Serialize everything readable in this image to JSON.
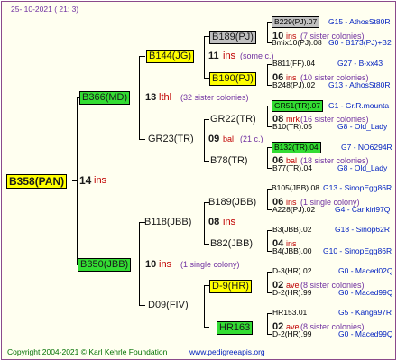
{
  "header": {
    "date": "25- 10-2021 ( 21: 3)"
  },
  "root": {
    "id": "B358(PAN)",
    "num": "14",
    "note": "ins"
  },
  "g1": [
    {
      "id": "B366(MD)",
      "num": "13",
      "note": "lthl",
      "sisters": "(32 sister colonies)"
    },
    {
      "id": "B350(JBB)",
      "num": "10",
      "note": "ins",
      "sisters": "(1 single colony)"
    }
  ],
  "g2": [
    {
      "id": "B144(JG)",
      "num": "11",
      "note": "ins",
      "sisters": "(some c.)"
    },
    {
      "id": "GR23(TR)",
      "num": "09",
      "note": "bal",
      "sisters": "(21 c.)"
    },
    {
      "id": "B118(JBB)",
      "num": "08",
      "note": "ins",
      "sisters": ""
    },
    {
      "id": "D09(FIV)",
      "num": "",
      "note": "",
      "sisters": ""
    }
  ],
  "g3": [
    {
      "id": "B189(PJ)",
      "num": "10",
      "note": "ins",
      "sisters": "(7 sister colonies)"
    },
    {
      "id": "B190(PJ)",
      "num": "06",
      "note": "ins",
      "sisters": "(10 sister colonies)"
    },
    {
      "id": "GR22(TR)",
      "num": "08",
      "note": "mrk",
      "sisters": "(16 sister colonies)"
    },
    {
      "id": "B78(TR)",
      "num": "06",
      "note": "bal",
      "sisters": "(18 sister colonies)"
    },
    {
      "id": "B189(JBB)",
      "num": "06",
      "note": "ins",
      "sisters": "(1 single colony)"
    },
    {
      "id": "B82(JBB)",
      "num": "04",
      "note": "ins",
      "sisters": ""
    },
    {
      "id": "D-9(HR)",
      "num": "02",
      "note": "ave",
      "sisters": "(8 sister colonies)"
    },
    {
      "id": "HR163",
      "num": "02",
      "note": "ave",
      "sisters": "(8 sister colonies)"
    }
  ],
  "g4": [
    {
      "left": "B229(PJ).07",
      "right": "G15 - AthosSt80R"
    },
    {
      "left": "Bmix10(PJ).08",
      "right": "G0 - B173(PJ)+B2"
    },
    {
      "left": "B811(FF).04",
      "right": "G27 - B-xx43"
    },
    {
      "left": "B248(PJ).02",
      "right": "G13 - AthosSt80R"
    },
    {
      "left": "GR51(TR).07",
      "right": "G1 - Gr.R.mounta"
    },
    {
      "left": "B10(TR).05",
      "right": "G8 - Old_Lady"
    },
    {
      "left": "B132(TR).04",
      "right": "G7 - NO6294R"
    },
    {
      "left": "B77(TR).04",
      "right": "G8 - Old_Lady"
    },
    {
      "left": "B105(JBB).08",
      "right": "G13 - SinopEgg86R"
    },
    {
      "left": "A228(PJ).02",
      "right": "G4 - Cankiri97Q"
    },
    {
      "left": "B3(JBB).02",
      "right": "G18 - Sinop62R"
    },
    {
      "left": "B4(JBB).00",
      "right": "G10 - SinopEgg86R"
    },
    {
      "left": "D-3(HR).02",
      "right": "G0 - Maced02Q"
    },
    {
      "left": "D-2(HR).99",
      "right": "G0 - Maced99Q"
    },
    {
      "left": "HR153.01",
      "right": "G5 - Kanga97R"
    },
    {
      "left": "D-2(HR).99",
      "right": "G0 - Maced99Q"
    }
  ],
  "footer": {
    "copyright": "Copyright 2004-2021 © Karl Kehrle Foundation",
    "site": "www.pedigreeapis.org"
  },
  "colors": {
    "frame": "#8b4a8b",
    "bg": "#fffff0",
    "yellow": "#ffff00",
    "green": "#33dd33",
    "grey": "#c0c0c0"
  }
}
